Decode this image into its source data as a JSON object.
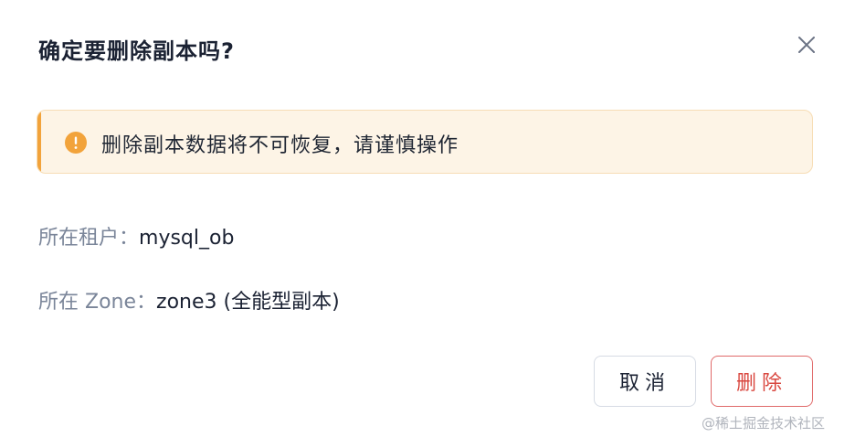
{
  "dialog": {
    "title": "确定要删除副本吗?",
    "alert_text": "删除副本数据将不可恢复，请谨慎操作",
    "fields": [
      {
        "label": "所在租户：",
        "value": "mysql_ob"
      },
      {
        "label": "所在 Zone：",
        "value": "zone3 (全能型副本)"
      }
    ],
    "cancel_label": "取消",
    "delete_label": "删除"
  },
  "watermark": "@稀土掘金技术社区",
  "colors": {
    "warning": "#f2a33b",
    "danger": "#d9473f",
    "alert_bg": "#fdf4e6"
  },
  "icons": [
    "close-icon",
    "warning-icon"
  ]
}
